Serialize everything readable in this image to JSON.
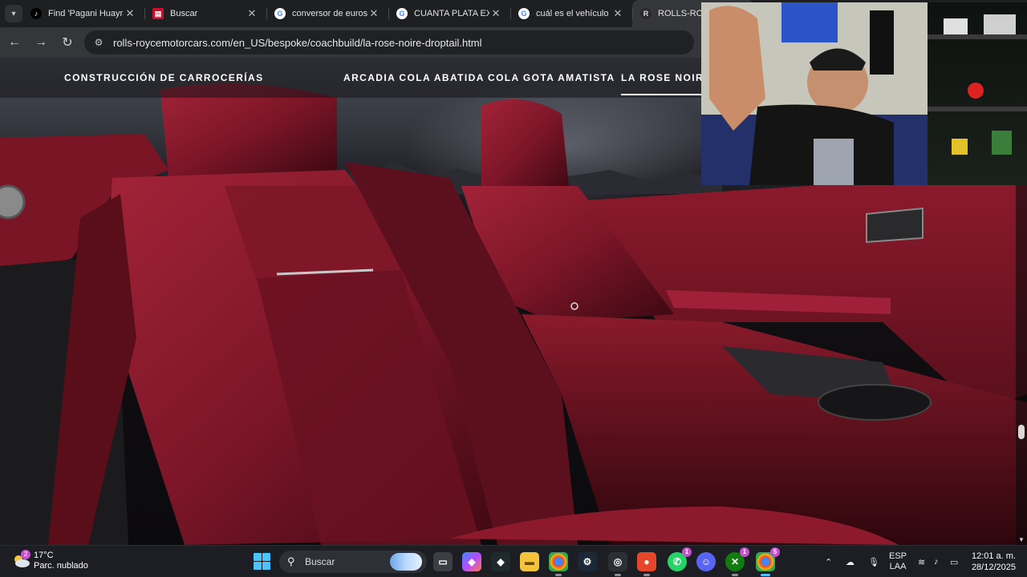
{
  "browser": {
    "tabs": [
      {
        "title": "Find 'Pagani Huayra",
        "favicon": "tiktok-icon",
        "active": false
      },
      {
        "title": "Buscar",
        "favicon": "buscar-icon",
        "active": false
      },
      {
        "title": "conversor de euros a",
        "favicon": "google-icon",
        "active": false
      },
      {
        "title": "CUANTA PLATA EXIS",
        "favicon": "google-icon",
        "active": false
      },
      {
        "title": "cuál es el vehículo de",
        "favicon": "google-icon",
        "active": false
      },
      {
        "title": "ROLLS-ROYC",
        "favicon": "rolls-royce-icon",
        "active": true
      }
    ],
    "url": "rolls-roycemotorcars.com/en_US/bespoke/coachbuild/la-rose-noire-droptail.html"
  },
  "site_nav": {
    "construccion": "CONSTRUCCIÓN DE CARROCERÍAS",
    "arcadia": "ARCADIA COLA ABATIDA",
    "amatista": "COLA GOTA AMATISTA",
    "rose_noire": "LA ROSE NOIRE"
  },
  "taskbar": {
    "weather_temp": "17°C",
    "weather_desc": "Parc. nublado",
    "weather_badge": "2",
    "search_placeholder": "Buscar",
    "whatsapp_badge": "1",
    "xbox_badge": "1",
    "chrome_badge": "5",
    "lang_top": "ESP",
    "lang_bottom": "LAA",
    "time": "12:01 a. m.",
    "date": "28/12/2025"
  },
  "colors": {
    "leather": "#8a1a2c",
    "leather_dark": "#4a0c17",
    "accent": "#4cc2ff"
  }
}
